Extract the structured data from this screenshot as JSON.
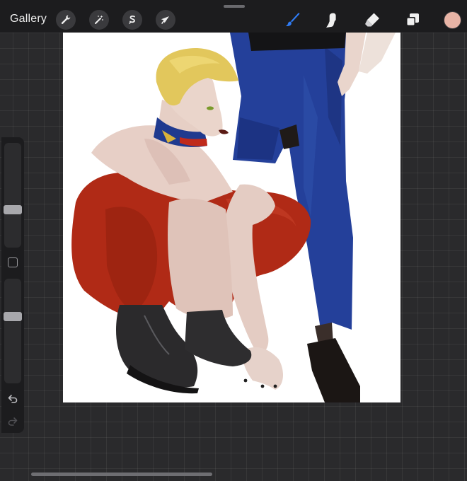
{
  "toolbar": {
    "gallery_label": "Gallery",
    "left_tools": [
      "wrench-icon",
      "magic-wand-icon",
      "selection-s-icon",
      "arrow-transform-icon"
    ],
    "right_tools": [
      "brush-icon",
      "smudge-icon",
      "eraser-icon",
      "layers-icon"
    ],
    "active_tool": "brush",
    "active_color": "#e8b4a6",
    "accent_color": "#2f7cf6"
  },
  "sidebar": {
    "brush_size": 0.35,
    "opacity": 0.65,
    "undo_icon": "undo-icon",
    "redo_icon": "redo-icon"
  },
  "canvas": {
    "artwork": "artwork-illustration"
  }
}
